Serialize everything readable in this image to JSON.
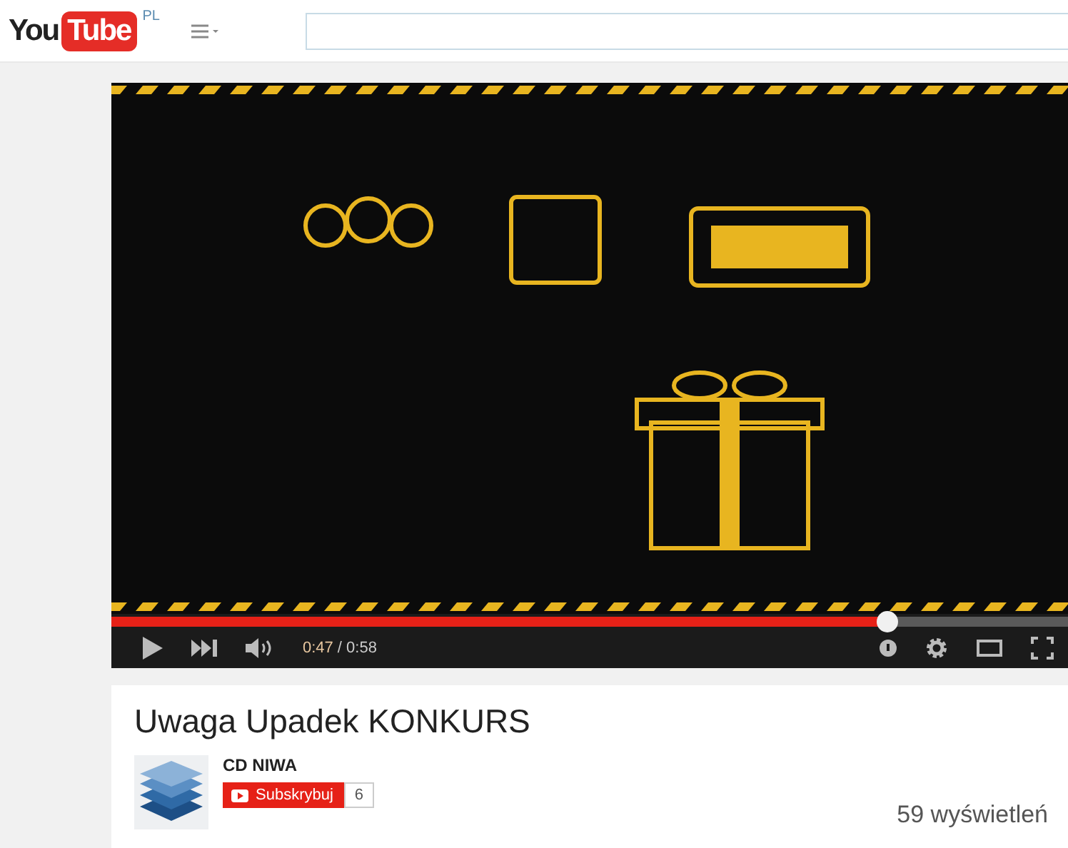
{
  "header": {
    "logo_left": "You",
    "logo_right": "Tube",
    "region": "PL"
  },
  "player": {
    "kind": "picture",
    "progress": {
      "level": 0.81
    },
    "time_current": "0:47",
    "time_total": "/ 0:58"
  },
  "video": {
    "title": "Uwaga Upadek KONKURS",
    "channel": "CD NIWA",
    "subscribe_label": "Subskrybuj",
    "subscriber_count": "6",
    "views": "59 wyświetleń"
  }
}
